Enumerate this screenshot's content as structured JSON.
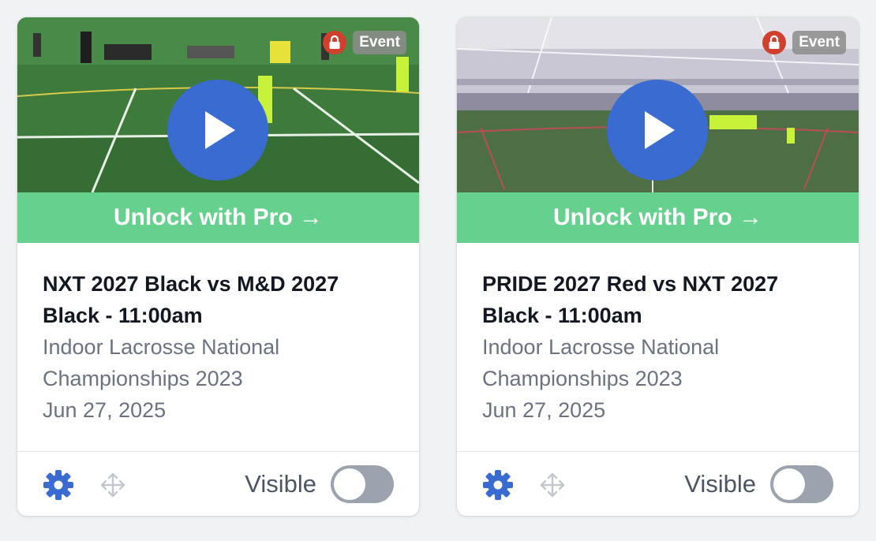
{
  "colors": {
    "accent_blue": "#3a6bd0",
    "unlock_green": "#66d18f",
    "lock_red": "#d0402e",
    "toggle_off": "#9ca3af"
  },
  "cards": [
    {
      "badge": "Event",
      "unlock_label": "Unlock with Pro →",
      "title": "NXT 2027 Black vs M&D 2027 Black - 11:00am",
      "event_name_line1": "Indoor Lacrosse National",
      "event_name_line2": "Championships 2023",
      "date": "Jun 27, 2025",
      "visible_label": "Visible",
      "visible": false,
      "icons": [
        "lock-icon",
        "play-icon",
        "gear-icon",
        "move-icon"
      ]
    },
    {
      "badge": "Event",
      "unlock_label": "Unlock with Pro →",
      "title": "PRIDE 2027 Red vs NXT 2027 Black - 11:00am",
      "event_name_line1": "Indoor Lacrosse National",
      "event_name_line2": "Championships 2023",
      "date": "Jun 27, 2025",
      "visible_label": "Visible",
      "visible": false,
      "icons": [
        "lock-icon",
        "play-icon",
        "gear-icon",
        "move-icon"
      ]
    }
  ]
}
